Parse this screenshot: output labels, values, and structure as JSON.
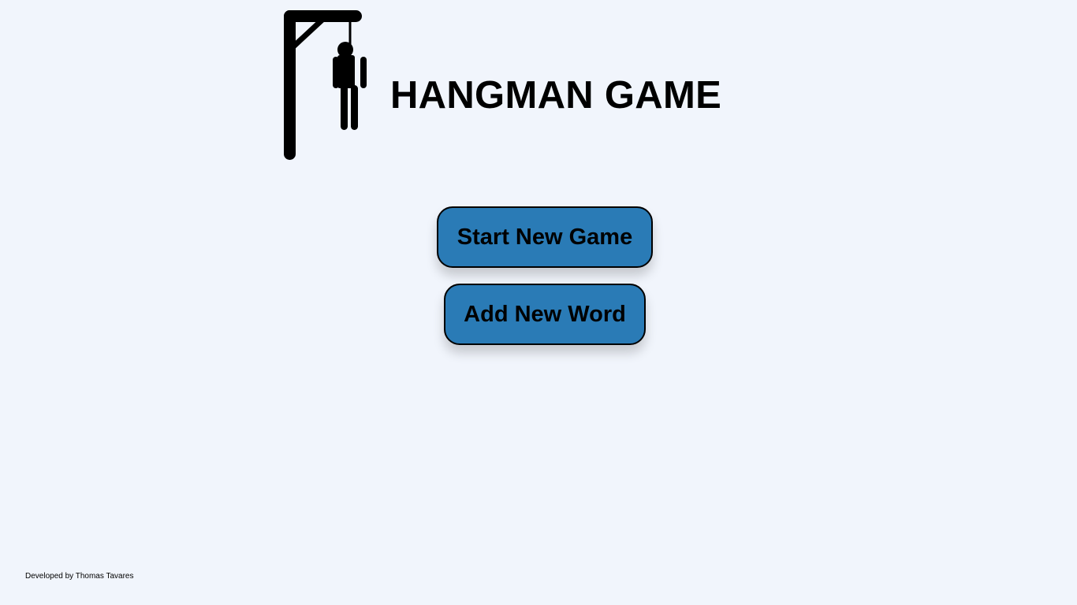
{
  "header": {
    "logo_icon": "hangman-gallows-icon",
    "title": "HANGMAN GAME"
  },
  "menu": {
    "start_label": "Start New Game",
    "add_word_label": "Add New Word"
  },
  "footer": {
    "credit": "Developed by Thomas Tavares"
  },
  "colors": {
    "background": "#f1f5fc",
    "button": "#2a7bb6",
    "text": "#000000"
  }
}
